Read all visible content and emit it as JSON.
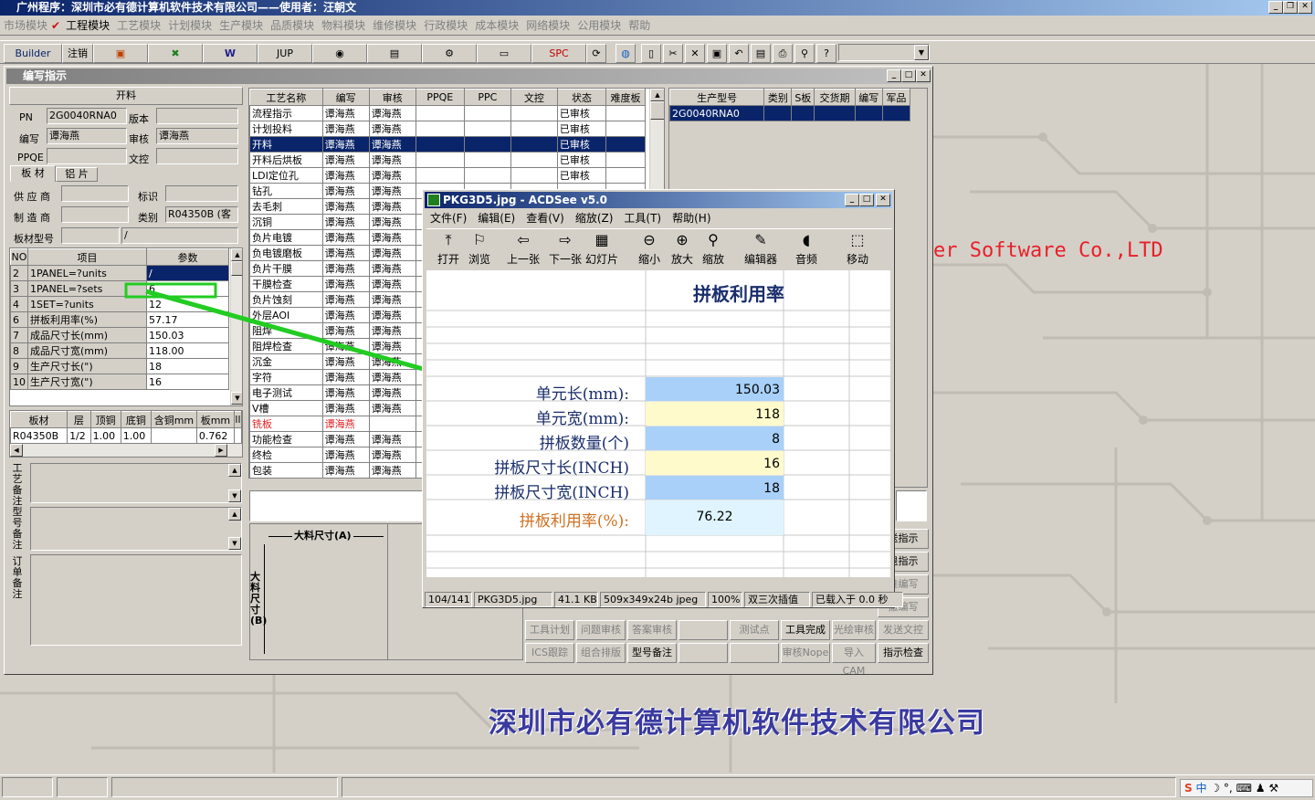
{
  "app": {
    "title": "广州程序：深圳市必有德计算机软件技术有限公司——使用者：汪朝文"
  },
  "menu": [
    "市场模块",
    "工程模块",
    "工艺模块",
    "计划模块",
    "生产模块",
    "品质模块",
    "物料模块",
    "维修模块",
    "行政模块",
    "成本模块",
    "网络模块",
    "公用模块",
    "帮助"
  ],
  "toolbar": {
    "builder": "Builder",
    "logout": "注销",
    "jup": "JUP",
    "spc": "SPC"
  },
  "window": {
    "title": "编写指示"
  },
  "form": {
    "section_title": "开料",
    "pn_label": "PN",
    "pn_value": "2G0040RNA0",
    "version_label": "版本",
    "writer_label": "编写",
    "writer_value": "谭海燕",
    "reviewer_label": "审核",
    "reviewer_value": "谭海燕",
    "ppqe_label": "PPQE",
    "doc_label": "文控",
    "tabs": [
      "板 材",
      "铝 片"
    ],
    "supplier_label": "供 应 商",
    "mark_label": "标识",
    "maker_label": "制 造 商",
    "category_label": "类别",
    "category_value": "R04350B (客",
    "board_model_label": "板材型号",
    "board_model_value": "/"
  },
  "params": {
    "headers": [
      "NO",
      "项目",
      "参数"
    ],
    "rows": [
      [
        "2",
        "1PANEL=?units",
        "/"
      ],
      [
        "3",
        "1PANEL=?sets",
        "6"
      ],
      [
        "4",
        "1SET=?units",
        "12"
      ],
      [
        "6",
        "拼板利用率(%)",
        "57.17"
      ],
      [
        "7",
        "成品尺寸长(mm)",
        "150.03"
      ],
      [
        "8",
        "成品尺寸宽(mm)",
        "118.00"
      ],
      [
        "9",
        "生产尺寸长(\")",
        "18"
      ],
      [
        "10",
        "生产尺寸宽(\")",
        "16"
      ]
    ]
  },
  "material": {
    "headers": [
      "板材",
      "层",
      "顶铜",
      "底铜",
      "含铜mm",
      "板mm",
      "ll"
    ],
    "row": [
      "R04350B",
      "1/2",
      "1.00",
      "1.00",
      "",
      "0.762",
      ""
    ]
  },
  "remarks": {
    "craft": "工艺备注",
    "model": "型号备注",
    "order": "订单备注"
  },
  "process": {
    "headers": [
      "工艺名称",
      "编写",
      "审核",
      "PPQE",
      "PPC",
      "文控",
      "状态",
      "难度板"
    ],
    "rows": [
      [
        "流程指示",
        "谭海燕",
        "谭海燕",
        "",
        "",
        "",
        "已审核"
      ],
      [
        "计划投料",
        "谭海燕",
        "谭海燕",
        "",
        "",
        "",
        "已审核"
      ],
      [
        "开料",
        "谭海燕",
        "谭海燕",
        "",
        "",
        "",
        "已审核"
      ],
      [
        "开料后烘板",
        "谭海燕",
        "谭海燕",
        "",
        "",
        "",
        "已审核"
      ],
      [
        "LDI定位孔",
        "谭海燕",
        "谭海燕",
        "",
        "",
        "",
        "已审核"
      ],
      [
        "钻孔",
        "谭海燕",
        "谭海燕",
        "",
        "",
        "",
        ""
      ],
      [
        "去毛刺",
        "谭海燕",
        "谭海燕",
        "",
        "",
        "",
        ""
      ],
      [
        "沉铜",
        "谭海燕",
        "谭海燕",
        "",
        "",
        "",
        ""
      ],
      [
        "负片电镀",
        "谭海燕",
        "谭海燕",
        "",
        "",
        "",
        ""
      ],
      [
        "负电镀磨板",
        "谭海燕",
        "谭海燕",
        "",
        "",
        "",
        ""
      ],
      [
        "负片干膜",
        "谭海燕",
        "谭海燕",
        "",
        "",
        "",
        ""
      ],
      [
        "干膜检查",
        "谭海燕",
        "谭海燕",
        "",
        "",
        "",
        ""
      ],
      [
        "负片蚀刻",
        "谭海燕",
        "谭海燕",
        "",
        "",
        "",
        ""
      ],
      [
        "外层AOI",
        "谭海燕",
        "谭海燕",
        "",
        "",
        "",
        ""
      ],
      [
        "阻焊",
        "谭海燕",
        "谭海燕",
        "",
        "",
        "",
        ""
      ],
      [
        "阻焊检查",
        "谭海燕",
        "谭海燕",
        "",
        "",
        "",
        ""
      ],
      [
        "沉金",
        "谭海燕",
        "谭海燕",
        "",
        "",
        "",
        ""
      ],
      [
        "字符",
        "谭海燕",
        "谭海燕",
        "",
        "",
        "",
        ""
      ],
      [
        "电子测试",
        "谭海燕",
        "谭海燕",
        "",
        "",
        "",
        ""
      ],
      [
        "V槽",
        "谭海燕",
        "谭海燕",
        "",
        "",
        "",
        ""
      ],
      [
        "铣板",
        "谭海燕",
        "",
        "",
        "",
        "",
        ""
      ],
      [
        "功能检查",
        "谭海燕",
        "谭海燕",
        "",
        "",
        "",
        ""
      ],
      [
        "终检",
        "谭海燕",
        "谭海燕",
        "",
        "",
        "",
        ""
      ],
      [
        "包装",
        "谭海燕",
        "谭海燕",
        "",
        "",
        "",
        ""
      ]
    ]
  },
  "orders": {
    "headers": [
      "生产型号",
      "类别",
      "S板",
      "交货期",
      "编写",
      "军品"
    ],
    "row": [
      "2G0040RNA0",
      "",
      "",
      "",
      "",
      ""
    ]
  },
  "drawing": {
    "width_label": "大料尺寸(A)",
    "height_label": "大料尺寸(B)"
  },
  "buttons": {
    "row1": [
      "送指示"
    ],
    "row2": [
      "退指示"
    ],
    "row3": [
      "准编写"
    ],
    "row4": [
      "撤编写"
    ],
    "row5": [
      "工具计划",
      "问题审核",
      "答案审核",
      "",
      "测试点",
      "工具完成",
      "光绘审核",
      "发送文控"
    ],
    "row6": [
      "ICS跟踪",
      "组合排版",
      "型号备注",
      "",
      "",
      "审核Nope",
      "导入CAM",
      "指示检查"
    ]
  },
  "watermark": {
    "software": "er Software Co.,LTD",
    "company": "深圳市必有德计算机软件技术有限公司"
  },
  "acdsee": {
    "title": "PKG3D5.jpg - ACDSee v5.0",
    "menu": [
      "文件(F)",
      "编辑(E)",
      "查看(V)",
      "缩放(Z)",
      "工具(T)",
      "帮助(H)"
    ],
    "tools": [
      "打开",
      "浏览",
      "上一张",
      "下一张",
      "幻灯片",
      "缩小",
      "放大",
      "缩放",
      "编辑器",
      "音频",
      "移动"
    ],
    "sheet": {
      "title": "拼板利用率",
      "rows": [
        {
          "label": "单元长(mm):",
          "value": "150.03"
        },
        {
          "label": "单元宽(mm):",
          "value": "118"
        },
        {
          "label": "拼板数量(个)",
          "value": "8"
        },
        {
          "label": "拼板尺寸长(INCH)",
          "value": "16"
        },
        {
          "label": "拼板尺寸宽(INCH)",
          "value": "18"
        }
      ],
      "result_label": "拼板利用率(%):",
      "result_value": "76.22"
    },
    "status": [
      "104/141",
      "PKG3D5.jpg",
      "41.1 KB",
      "509x349x24b jpeg",
      "100%",
      "双三次插值",
      "已载入于 0.0 秒"
    ]
  },
  "colors": {
    "accent": "#0a246a",
    "arrow": "#22cc22",
    "watermark": "#e8202a",
    "company": "#3a3aa0"
  }
}
